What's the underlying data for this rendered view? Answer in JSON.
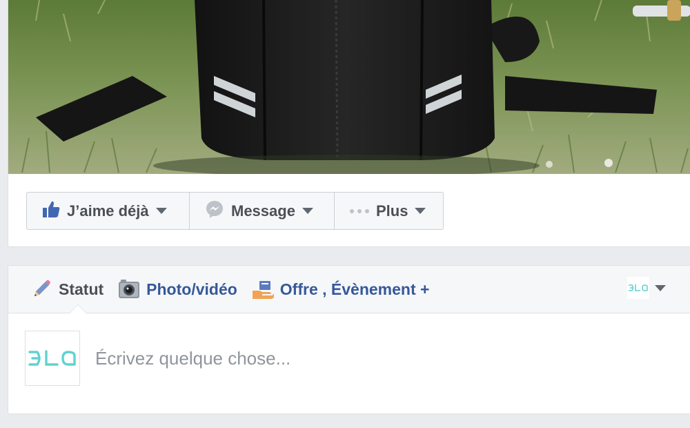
{
  "cover": {
    "image_subject": "black backpack on grass"
  },
  "actions": {
    "like_label": "J’aime déjà",
    "message_label": "Message",
    "more_label": "Plus"
  },
  "composer": {
    "tabs": {
      "status_label": "Statut",
      "photo_label": "Photo/vidéo",
      "offer_label": "Offre , Évènement +"
    },
    "placeholder": "Écrivez quelque chose..."
  },
  "colors": {
    "link_blue": "#365899",
    "text_gray": "#4b4f56",
    "placeholder_gray": "#90949c",
    "logo_teal": "#5fd3d0",
    "background": "#e9ebee"
  },
  "icons": [
    "thumbs-up-icon",
    "messenger-icon",
    "more-dots-icon",
    "pencil-icon",
    "camera-icon",
    "offer-hand-icon",
    "page-logo-icon"
  ]
}
